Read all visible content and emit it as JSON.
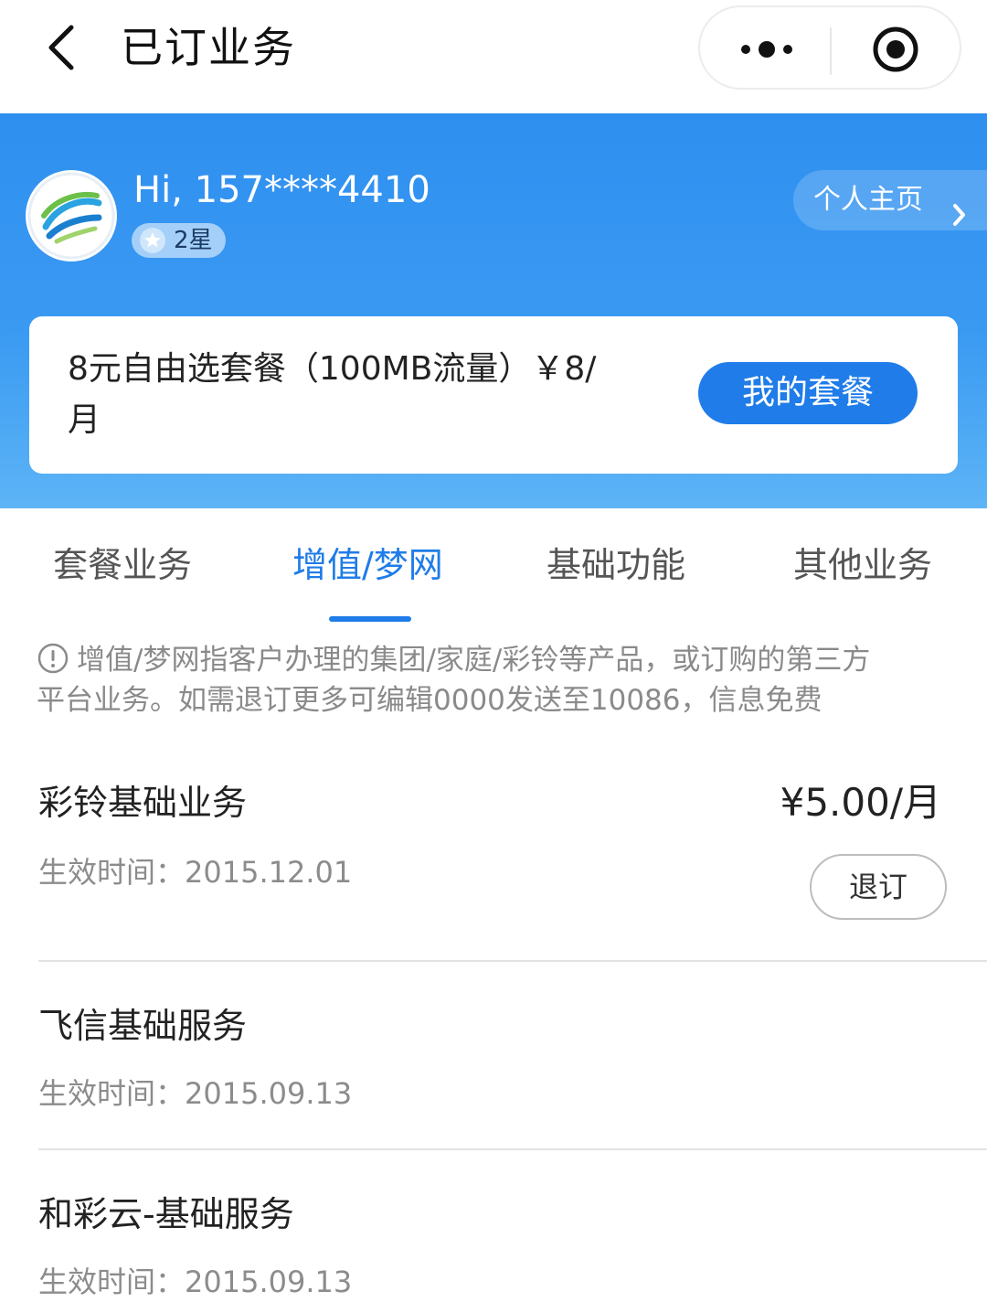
{
  "nav": {
    "title": "已订业务",
    "back_icon": "back-arrow-icon",
    "more_icon": "more-dots-icon",
    "close_icon": "target-close-icon"
  },
  "header": {
    "greeting": "Hi, 157****4410",
    "level": "2星",
    "home_link": "个人主页",
    "logo_icon": "china-mobile-logo",
    "colors": {
      "banner_top": "#2f8ff0",
      "banner_bottom": "#5db4f6",
      "accent": "#1f7ce8"
    }
  },
  "plan": {
    "line1": "8元自由选套餐（100MB流量）￥8/",
    "line2": "月",
    "button": "我的套餐"
  },
  "tabs": [
    {
      "label": "套餐业务",
      "active": false
    },
    {
      "label": "增值/梦网",
      "active": true
    },
    {
      "label": "基础功能",
      "active": false
    },
    {
      "label": "其他业务",
      "active": false
    }
  ],
  "notice": {
    "line1": "增值/梦网指客户办理的集团/家庭/彩铃等产品，或订购的第三方",
    "line2": "平台业务。如需退订更多可编辑0000发送至10086，信息免费"
  },
  "services": [
    {
      "name": "彩铃基础业务",
      "price": "¥5.00/月",
      "date": "生效时间：2015.12.01",
      "action": "退订"
    },
    {
      "name": "飞信基础服务",
      "date": "生效时间：2015.09.13"
    },
    {
      "name": "和彩云-基础服务",
      "date": "生效时间：2015.09.13"
    }
  ]
}
